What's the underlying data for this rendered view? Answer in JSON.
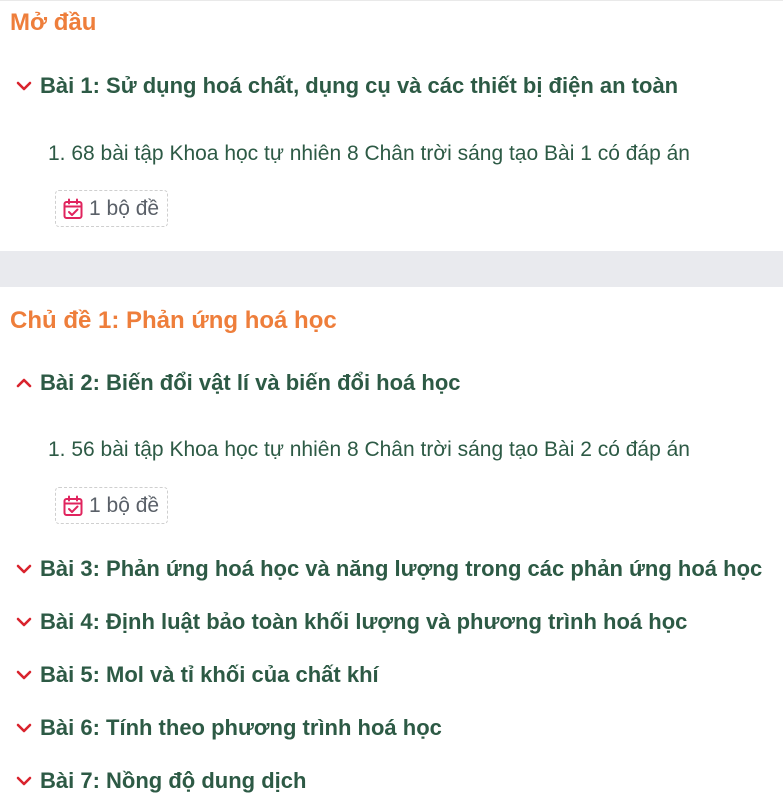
{
  "sections": [
    {
      "title": "Mở đầu",
      "lessons": [
        {
          "label": "Bài 1: Sử dụng hoá chất, dụng cụ và các thiết bị điện an toàn",
          "expanded": false,
          "item_number": "1.",
          "item_text": "68 bài tập Khoa học tự nhiên 8 Chân trời sáng tạo Bài 1 có đáp án",
          "badge": "1 bộ đề"
        }
      ]
    },
    {
      "title": "Chủ đề 1: Phản ứng hoá học",
      "lessons": [
        {
          "label": "Bài 2: Biến đổi vật lí và biến đổi hoá học",
          "expanded": true,
          "item_number": "1.",
          "item_text": "56 bài tập Khoa học tự nhiên 8 Chân trời sáng tạo Bài 2 có đáp án",
          "badge": "1 bộ đề"
        },
        {
          "label": "Bài 3: Phản ứng hoá học và năng lượng trong các phản ứng hoá học",
          "expanded": false
        },
        {
          "label": "Bài 4: Định luật bảo toàn khối lượng và phương trình hoá học",
          "expanded": false
        },
        {
          "label": "Bài 5: Mol và tỉ khối của chất khí",
          "expanded": false
        },
        {
          "label": "Bài 6: Tính theo phương trình hoá học",
          "expanded": false
        },
        {
          "label": "Bài 7: Nồng độ dung dịch",
          "expanded": false
        }
      ]
    }
  ],
  "colors": {
    "section_title": "#ee7e3b",
    "lesson_text": "#2d5a45",
    "chevron": "#d9232d",
    "calendar_icon": "#e0245e",
    "badge_text": "#5a6068",
    "separator": "#e9eaee"
  },
  "icons": {
    "collapsed": "chevron-down-icon",
    "expanded": "chevron-up-icon",
    "badge": "calendar-check-icon"
  }
}
